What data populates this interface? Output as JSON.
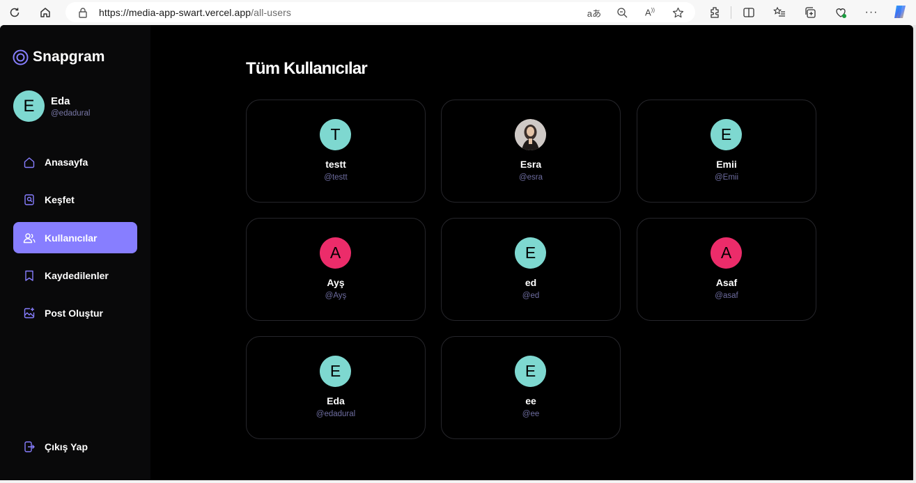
{
  "browser": {
    "url_host": "https://media-app-swart.vercel.app",
    "url_path": "/all-users"
  },
  "sidebar": {
    "logo_text": "Snapgram",
    "profile": {
      "initial": "E",
      "name": "Eda",
      "handle": "@edadural"
    },
    "items": [
      {
        "label": "Anasayfa",
        "icon": "home-icon",
        "active": false
      },
      {
        "label": "Keşfet",
        "icon": "explore-icon",
        "active": false
      },
      {
        "label": "Kullanıcılar",
        "icon": "people-icon",
        "active": true
      },
      {
        "label": "Kaydedilenler",
        "icon": "bookmark-icon",
        "active": false
      },
      {
        "label": "Post Oluştur",
        "icon": "create-post-icon",
        "active": false
      }
    ],
    "logout_label": "Çıkış Yap"
  },
  "main": {
    "title": "Tüm Kullanıcılar",
    "users": [
      {
        "initial": "T",
        "name": "testt",
        "handle": "@testt",
        "color": "#7ed8d0",
        "photo": false
      },
      {
        "initial": "",
        "name": "Esra",
        "handle": "@esra",
        "color": "#ffffff",
        "photo": true
      },
      {
        "initial": "E",
        "name": "Emii",
        "handle": "@Emii",
        "color": "#7ed8d0",
        "photo": false
      },
      {
        "initial": "A",
        "name": "Ayş",
        "handle": "@Ayş",
        "color": "#ec2c6a",
        "photo": false
      },
      {
        "initial": "E",
        "name": "ed",
        "handle": "@ed",
        "color": "#7ed8d0",
        "photo": false
      },
      {
        "initial": "A",
        "name": "Asaf",
        "handle": "@asaf",
        "color": "#ec2c6a",
        "photo": false
      },
      {
        "initial": "E",
        "name": "Eda",
        "handle": "@edadural",
        "color": "#7ed8d0",
        "photo": false
      },
      {
        "initial": "E",
        "name": "ee",
        "handle": "@ee",
        "color": "#7ed8d0",
        "photo": false
      }
    ]
  },
  "colors": {
    "accent": "#877eff",
    "teal_avatar": "#7ed8d0",
    "pink_avatar": "#ec2c6a"
  }
}
